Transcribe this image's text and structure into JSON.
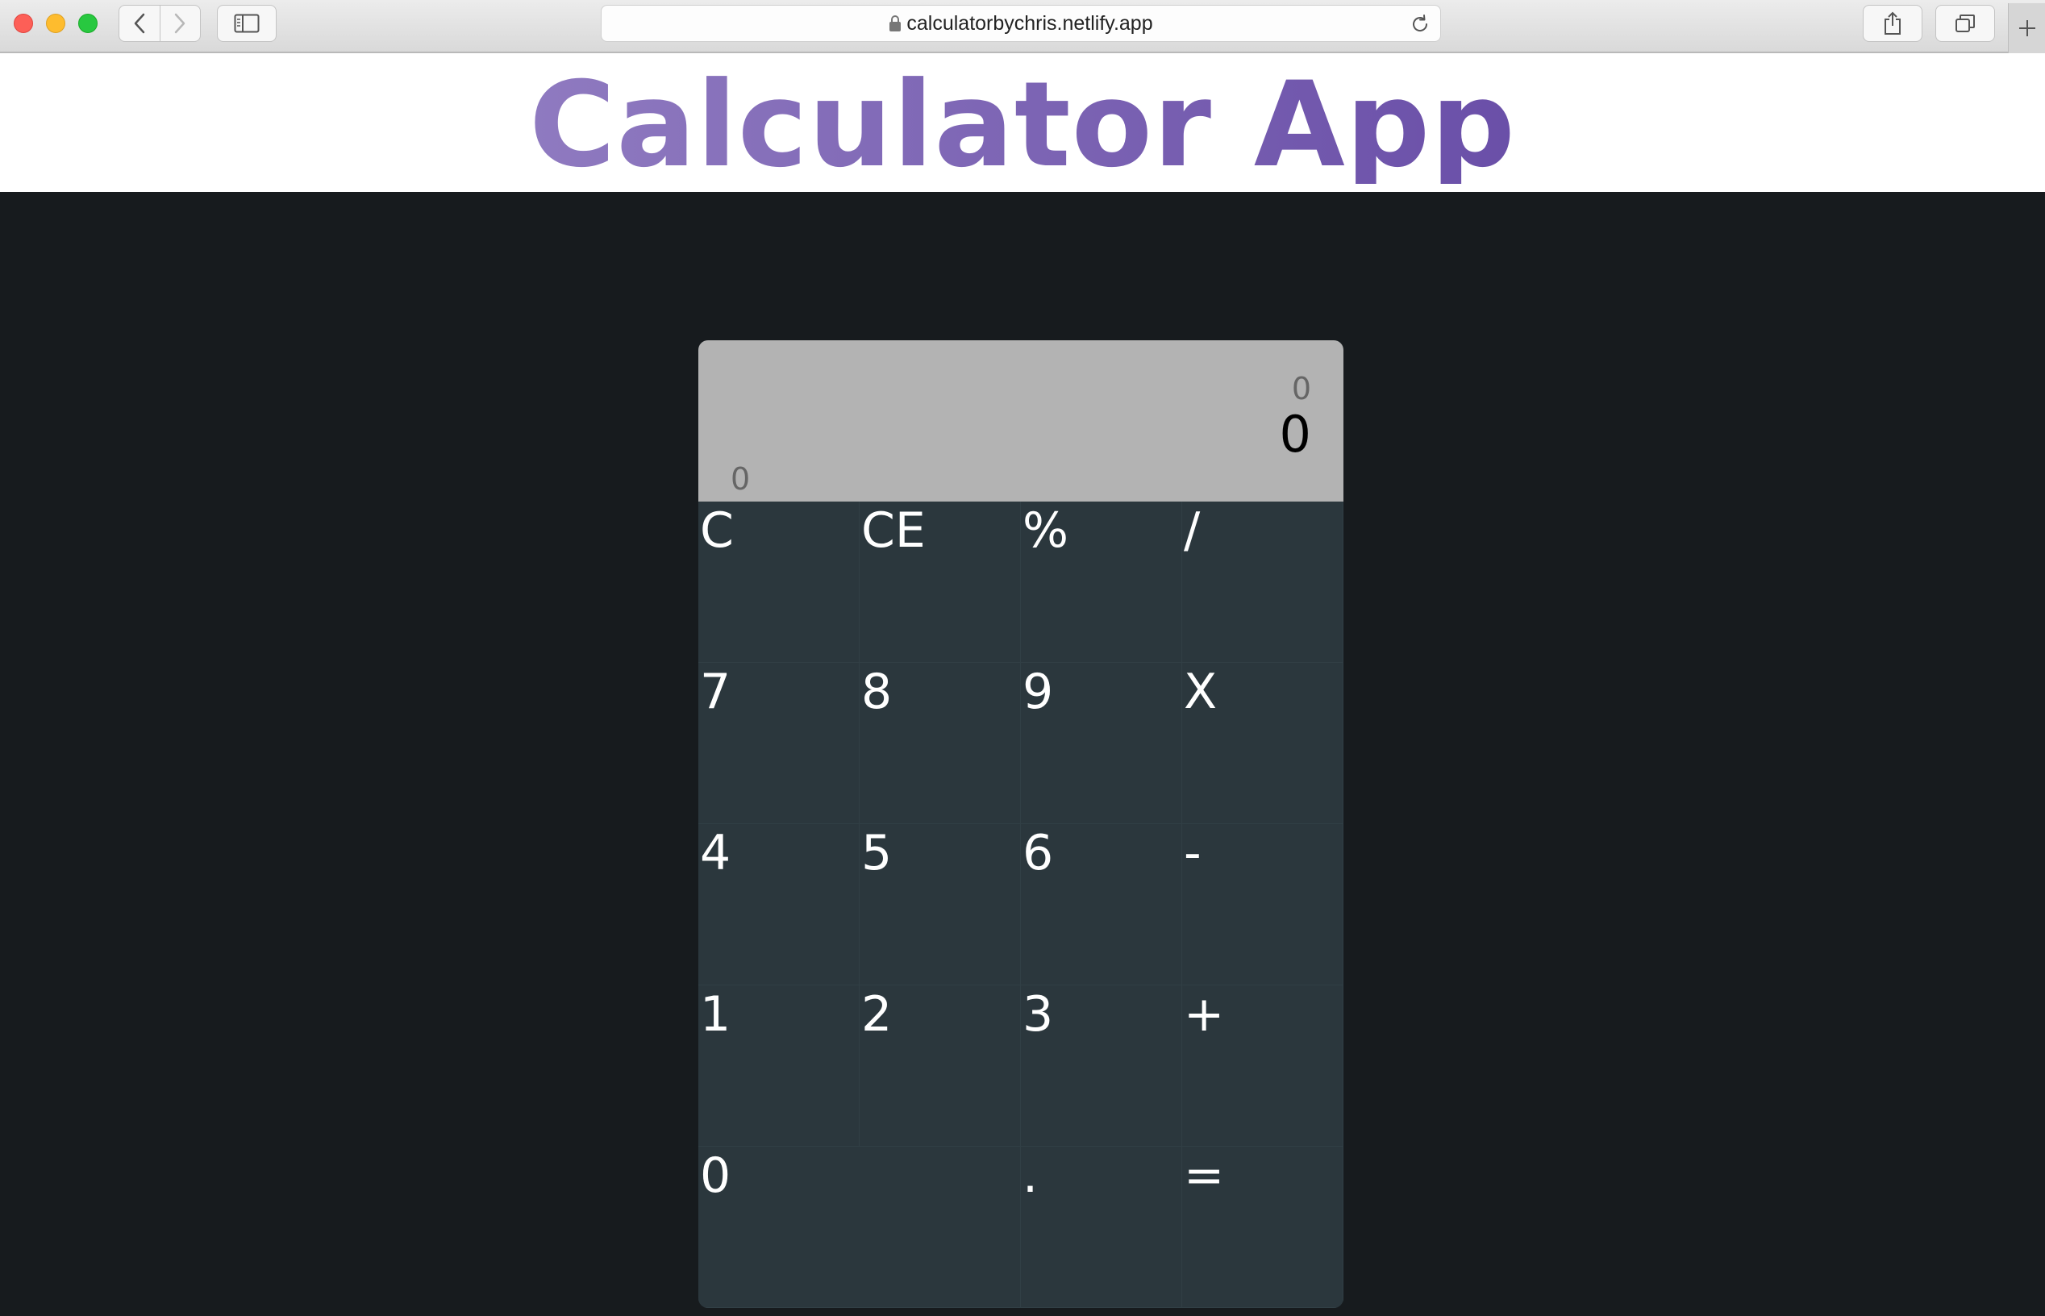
{
  "browser": {
    "url": "calculatorbychris.netlify.app"
  },
  "page": {
    "title": "Calculator App"
  },
  "display": {
    "previous_operand": "0",
    "current_operand": "0",
    "left_indicator": "0"
  },
  "keys": {
    "clear": "C",
    "clear_entry": "CE",
    "percent": "%",
    "divide": "/",
    "seven": "7",
    "eight": "8",
    "nine": "9",
    "multiply": "X",
    "four": "4",
    "five": "5",
    "six": "6",
    "subtract": "-",
    "one": "1",
    "two": "2",
    "three": "3",
    "add": "+",
    "zero": "0",
    "decimal": ".",
    "equals": "="
  },
  "colors": {
    "title_gradient_start": "#8f7ac0",
    "title_gradient_end": "#6a4fa8",
    "page_background": "#171b1e",
    "calculator_background": "#2b373d",
    "display_background": "#b3b3b3"
  }
}
